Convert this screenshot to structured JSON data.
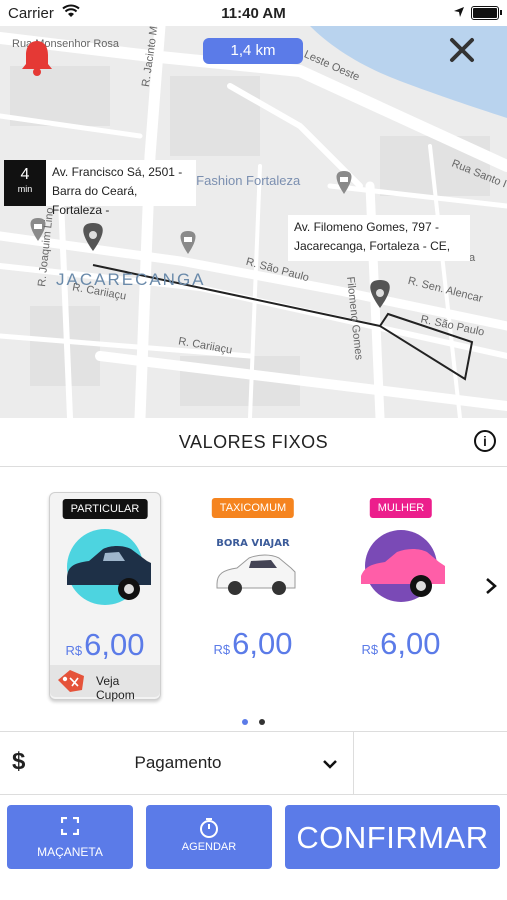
{
  "status_bar": {
    "carrier": "Carrier",
    "time": "11:40 AM"
  },
  "map": {
    "distance": "1,4 km",
    "eta": {
      "value": "4",
      "unit": "min"
    },
    "origin_address": "Av. Francisco Sá, 2501 - Barra do Ceará, Fortaleza -",
    "destination_address": "Av. Filomeno Gomes, 797 - Jacarecanga, Fortaleza - CE,",
    "labels": {
      "rua_monsenhor_rosa": "Rua Monsenhor Rosa",
      "r_jacinto_matos": "R. Jacinto Matos",
      "leste_oeste": "Leste Oeste",
      "rua_santo": "Rua Santo I",
      "fashion": "ro Fashion Fortaleza",
      "jacarecanga": "JACARECANGA",
      "r_sao_paulo_1": "R. São Paulo",
      "r_sao_paulo_2": "R. São Paulo",
      "r_sen_alencar": "R. Sen. Alencar",
      "r_jubana": "R. Jubana",
      "r_cariiacu_1": "R. Cariiaçu",
      "r_cariiacu_2": "R. Cariiaçu",
      "r_joaquim_lino": "R. Joaquim Lino",
      "filomeno_gomes": "Filomeno Gomes"
    }
  },
  "header": {
    "title": "VALORES FIXOS",
    "info_icon": "i"
  },
  "categories": [
    {
      "tag": "PARTICULAR",
      "tag_color": "#111111",
      "currency": "R$",
      "price": "6,00",
      "selected": true,
      "coupon_label": "Veja Cupom"
    },
    {
      "tag": "TAXICOMUM",
      "tag_color": "#f5841f",
      "currency": "R$",
      "price": "6,00",
      "selected": false,
      "logo_text": "BORA VIAJAR"
    },
    {
      "tag": "MULHER",
      "tag_color": "#ec1e8c",
      "currency": "R$",
      "price": "6,00",
      "selected": false
    }
  ],
  "pagination": {
    "total": 2,
    "active": 0
  },
  "payment": {
    "currency_icon": "$",
    "label": "Pagamento"
  },
  "actions": {
    "macaneta": "MAÇANETA",
    "agendar": "AGENDAR",
    "confirmar": "CONFIRMAR"
  },
  "colors": {
    "accent": "#5b7be8",
    "alert": "#e53935",
    "water": "#b9d3ee"
  }
}
